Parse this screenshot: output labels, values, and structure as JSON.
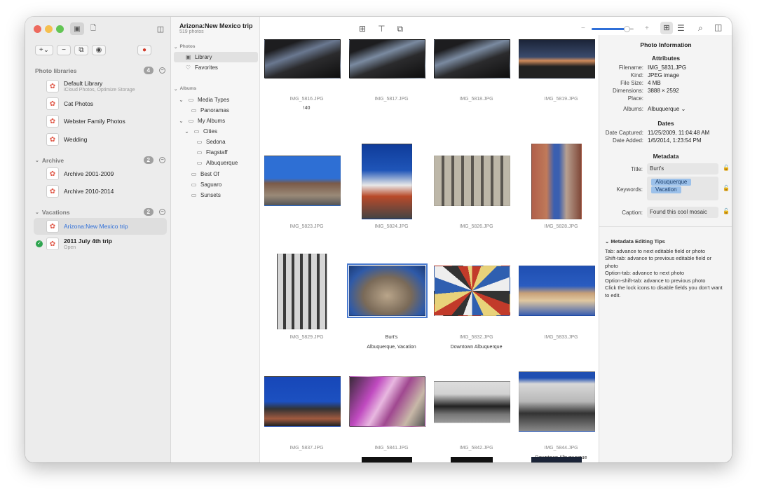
{
  "window": {
    "title": "Arizona:New Mexico trip",
    "subtitle": "519 photos"
  },
  "sidebar": {
    "sections": {
      "libraries": "Photo libraries",
      "libraries_count": "4",
      "archive": "Archive",
      "archive_count": "2",
      "vacations": "Vacations",
      "vacations_count": "2"
    },
    "libraries": [
      {
        "name": "Default Library",
        "sub": "iCloud Photos, Optimize Storage"
      },
      {
        "name": "Cat Photos"
      },
      {
        "name": "Webster Family Photos"
      },
      {
        "name": "Wedding"
      }
    ],
    "archive": [
      {
        "name": "Archive 2001-2009"
      },
      {
        "name": "Archive 2010-2014"
      }
    ],
    "vacations": [
      {
        "name": "Arizona:New Mexico trip"
      },
      {
        "name": "2011 July 4th trip",
        "sub": "Open"
      }
    ]
  },
  "albums": {
    "photos_header": "Photos",
    "library": "Library",
    "favorites": "Favorites",
    "albums_header": "Albums",
    "media_types": "Media Types",
    "panoramas": "Panoramas",
    "my_albums": "My Albums",
    "cities": "Cities",
    "sedona": "Sedona",
    "flagstaff": "Flagstaff",
    "albuquerque": "Albuquerque",
    "best_of": "Best Of",
    "saguaro": "Saguaro",
    "sunsets": "Sunsets"
  },
  "grid": {
    "photos": [
      {
        "name": "IMG_5816.JPG",
        "extra": "!40"
      },
      {
        "name": "IMG_5817.JPG"
      },
      {
        "name": "IMG_5818.JPG"
      },
      {
        "name": "IMG_5819.JPG"
      },
      {
        "name": "IMG_5823.JPG"
      },
      {
        "name": "IMG_5824.JPG"
      },
      {
        "name": "IMG_5826.JPG"
      },
      {
        "name": "IMG_5828.JPG"
      },
      {
        "name": "IMG_5829.JPG"
      },
      {
        "name": "Burt's",
        "extra": "Albuquerque, Vacation"
      },
      {
        "name": "IMG_5832.JPG",
        "extra": "Downtown Albuquerque"
      },
      {
        "name": "IMG_5833.JPG"
      },
      {
        "name": "IMG_5837.JPG"
      },
      {
        "name": "IMG_5841.JPG"
      },
      {
        "name": "IMG_5842.JPG"
      },
      {
        "name": "IMG_5844.JPG",
        "extra": "Downtown Albuquerque"
      }
    ]
  },
  "info": {
    "title": "Photo Information",
    "attributes": "Attributes",
    "filename_k": "Filename:",
    "filename": "IMG_5831.JPG",
    "kind_k": "Kind:",
    "kind": "JPEG image",
    "size_k": "File Size:",
    "size": "4 MB",
    "dim_k": "Dimensions:",
    "dim": "3888 × 2592",
    "place_k": "Place:",
    "albums_k": "Albums:",
    "albums": "Albuquerque",
    "dates": "Dates",
    "captured_k": "Date Captured:",
    "captured": "11/25/2009, 11:04:48 AM",
    "added_k": "Date Added:",
    "added": "1/6/2014, 1:23:54 PM",
    "metadata": "Metadata",
    "title_k": "Title:",
    "title_v": "Burt's",
    "keywords_k": "Keywords:",
    "kw1": "Alouquerque",
    "kw2": "Vacation",
    "caption_k": "Caption:",
    "caption": "Found this cool mosaic",
    "tips_title": "Metadata Editing Tips",
    "tips": [
      "Tab: advance to next editable field or photo",
      "Shift-tab: advance to previous editable field or photo",
      "Option-tab: advance to next photo",
      "Option-shift-tab: advance to previous photo",
      "Click the lock icons to disable fields you don't want to edit."
    ]
  }
}
